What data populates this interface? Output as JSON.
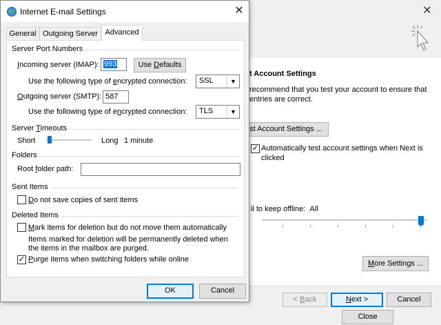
{
  "background_window": {
    "heading": "t Account Settings",
    "description": "recommend that you test your account to ensure that entries are correct.",
    "test_button": "est Account Settings ...",
    "auto_test_checkbox": {
      "label": "Automatically test account settings when Next is clicked",
      "checked": true
    },
    "offline_label": "il to keep offline:",
    "offline_value": "All",
    "offline_slider_level": 1.0,
    "more_settings_button": "More Settings ...",
    "back_button": "< Back",
    "next_button": "Next >",
    "cancel_button": "Cancel",
    "close_button": "Close",
    "close_icon": "close-icon",
    "cursor_icon": "click-cursor-icon"
  },
  "dialog": {
    "title": "Internet E-mail Settings",
    "title_icon": "globe-icon",
    "tabs": [
      {
        "label": "General",
        "active": false
      },
      {
        "label": "Outgoing Server",
        "active": false
      },
      {
        "label": "Advanced",
        "active": true
      }
    ],
    "server_ports": {
      "group": "Server Port Numbers",
      "incoming_label": "Incoming server (IMAP):",
      "incoming_value": "993",
      "use_defaults": "Use Defaults",
      "incoming_encryption_label": "Use the following type of encrypted connection:",
      "incoming_encryption_value": "SSL",
      "outgoing_label": "Outgoing server (SMTP):",
      "outgoing_value": "587",
      "outgoing_encryption_label": "Use the following type of encrypted connection:",
      "outgoing_encryption_value": "TLS"
    },
    "timeouts": {
      "group": "Server Timeouts",
      "short": "Short",
      "long": "Long",
      "value": "1 minute",
      "level": 0.05
    },
    "folders": {
      "group": "Folders",
      "root_label": "Root folder path:",
      "root_value": ""
    },
    "sent_items": {
      "group": "Sent Items",
      "dont_save_label": "Do not save copies of sent items",
      "dont_save_checked": false
    },
    "deleted_items": {
      "group": "Deleted Items",
      "mark_label": "Mark items for deletion but do not move them automatically",
      "mark_checked": false,
      "note": "Items marked for deletion will be permanently deleted when the items in the mailbox are purged.",
      "purge_label": "Purge items when switching folders while online",
      "purge_checked": true
    },
    "ok_button": "OK",
    "cancel_button": "Cancel",
    "accent_color": "#0078d7"
  }
}
